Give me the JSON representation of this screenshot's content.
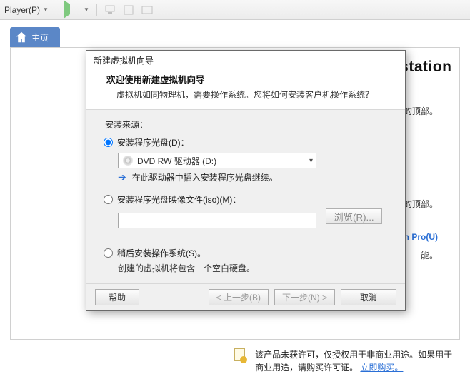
{
  "topbar": {
    "player_label": "Player(P)"
  },
  "hometab": {
    "label": "主页"
  },
  "main": {
    "heading": "欢迎使用 VMware Workstation",
    "bg_line1": "加到库的顶部。",
    "bg_line2": "添加到库的顶部。",
    "bg_line3": "tation Pro(U)",
    "bg_line3a": "能。"
  },
  "footer": {
    "text_a": "该产品未获许可，仅授权用于非商业用途。如果用于商业用途，请购买许可证。",
    "link": "立即购买。"
  },
  "wizard": {
    "title": "新建虚拟机向导",
    "head1": "欢迎使用新建虚拟机向导",
    "head2": "虚拟机如同物理机，需要操作系统。您将如何安装客户机操作系统？",
    "source_label": "安装来源：",
    "opt_disc": "安装程序光盘(D)：",
    "disc_select": "DVD RW 驱动器 (D:)",
    "disc_hint": "在此驱动器中插入安装程序光盘继续。",
    "opt_iso": "安装程序光盘映像文件(iso)(M)：",
    "browse": "浏览(R)...",
    "opt_later": "稍后安装操作系统(S)。",
    "later_sub": "创建的虚拟机将包含一个空白硬盘。",
    "btn_help": "帮助",
    "btn_back": "< 上一步(B)",
    "btn_next": "下一步(N) >",
    "btn_cancel": "取消"
  }
}
